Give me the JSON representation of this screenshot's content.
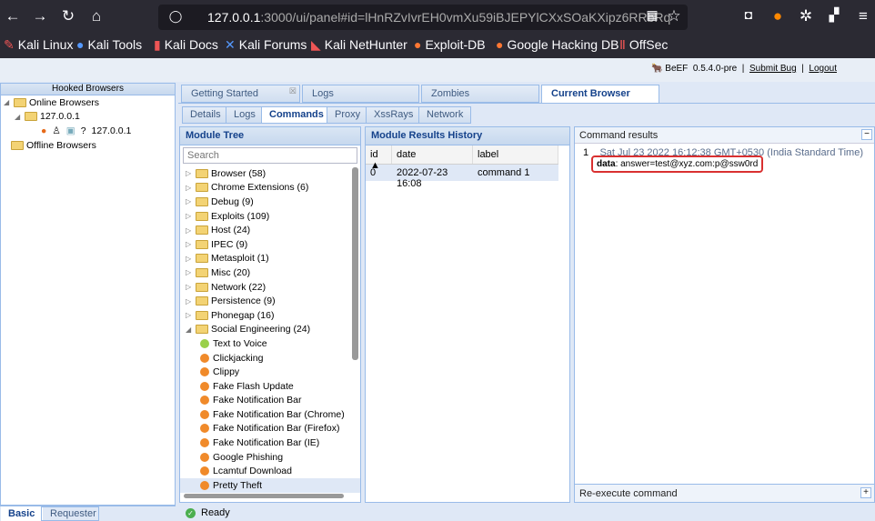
{
  "browser": {
    "url_host": "127.0.0.1",
    "url_rest": ":3000/ui/panel#id=lHnRZvIvrEH0vmXu59iBJEPYlCXxSOaKXipz6RRbRq",
    "bookmarks": [
      "Kali Linux",
      "Kali Tools",
      "Kali Docs",
      "Kali Forums",
      "Kali NetHunter",
      "Exploit-DB",
      "Google Hacking DB",
      "OffSec"
    ]
  },
  "header": {
    "app": "BeEF",
    "version": "0.5.4.0-pre",
    "sep": "|",
    "submit_bug": "Submit  Bug",
    "logout": "Logout"
  },
  "hooked": {
    "title": "Hooked Browsers",
    "online": "Online Browsers",
    "host": "127.0.0.1",
    "browser_ip": "127.0.0.1",
    "unknown": "?",
    "offline": "Offline Browsers"
  },
  "tabs": [
    "Getting Started",
    "Logs",
    "Zombies",
    "Current Browser"
  ],
  "subtabs": [
    "Details",
    "Logs",
    "Commands",
    "Proxy",
    "XssRays",
    "Network"
  ],
  "module_tree": {
    "title": "Module Tree",
    "search_placeholder": "Search",
    "categories": [
      "Browser (58)",
      "Chrome Extensions (6)",
      "Debug (9)",
      "Exploits (109)",
      "Host (24)",
      "IPEC (9)",
      "Metasploit (1)",
      "Misc (20)",
      "Network (22)",
      "Persistence (9)",
      "Phonegap (16)",
      "Social Engineering (24)"
    ],
    "modules": [
      {
        "name": "Text to Voice",
        "status": "green"
      },
      {
        "name": "Clickjacking",
        "status": "orange"
      },
      {
        "name": "Clippy",
        "status": "orange"
      },
      {
        "name": "Fake Flash Update",
        "status": "orange"
      },
      {
        "name": "Fake Notification Bar",
        "status": "orange"
      },
      {
        "name": "Fake Notification Bar (Chrome)",
        "status": "orange"
      },
      {
        "name": "Fake Notification Bar (Firefox)",
        "status": "orange"
      },
      {
        "name": "Fake Notification Bar (IE)",
        "status": "orange"
      },
      {
        "name": "Google Phishing",
        "status": "orange"
      },
      {
        "name": "Lcamtuf Download",
        "status": "orange"
      },
      {
        "name": "Pretty Theft",
        "status": "orange"
      }
    ]
  },
  "history": {
    "title": "Module Results History",
    "columns": [
      "id ▲",
      "date",
      "label"
    ],
    "rows": [
      [
        "0",
        "2022-07-23 16:08",
        "command 1"
      ]
    ]
  },
  "results": {
    "title": "Command results",
    "index": "1",
    "timestamp": "Sat Jul 23 2022 16:12:38 GMT+0530 (India Standard Time)",
    "data_key": "data",
    "data_value": ": answer=test@xyz.com:p@ssw0rd",
    "reexecute": "Re-execute command"
  },
  "bottom_tabs": [
    "Basic",
    "Requester"
  ],
  "status": "Ready"
}
